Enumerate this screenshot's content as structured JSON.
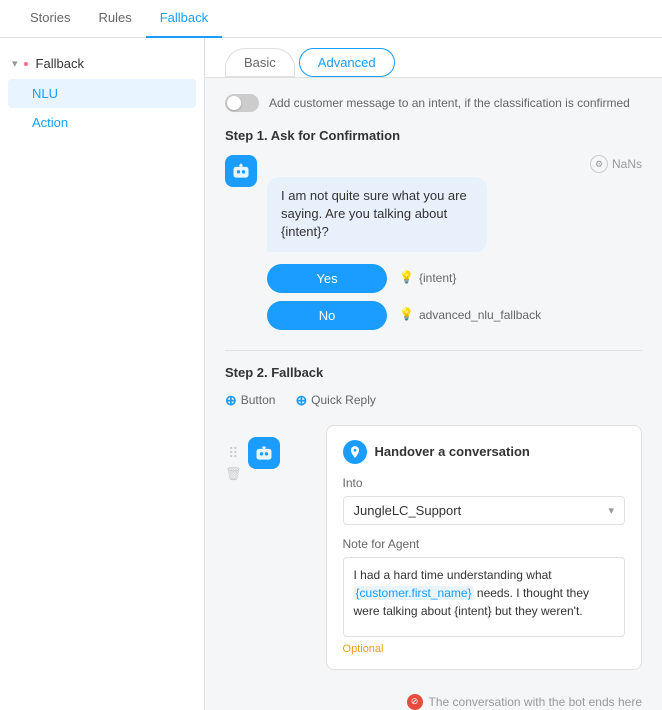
{
  "nav": {
    "items": [
      {
        "label": "Stories",
        "active": false
      },
      {
        "label": "Rules",
        "active": false
      },
      {
        "label": "Fallback",
        "active": true
      }
    ]
  },
  "sidebar": {
    "header": "Fallback",
    "items": [
      {
        "label": "NLU",
        "active": true
      },
      {
        "label": "Action",
        "active": false
      }
    ]
  },
  "tabs": {
    "basic": "Basic",
    "advanced": "Advanced"
  },
  "toggle": {
    "label": "Add customer message to an intent, if the classification is confirmed"
  },
  "step1": {
    "heading": "Step 1. Ask for Confirmation",
    "bot_message": "I am not quite sure what you are saying. Are you talking about {intent}?",
    "nans": "NaNs",
    "yes_label": "Yes",
    "no_label": "No",
    "yes_intent": "{intent}",
    "no_intent": "advanced_nlu_fallback"
  },
  "step2": {
    "heading": "Step 2. Fallback",
    "add_button_label": "Button",
    "add_quick_reply_label": "Quick Reply",
    "handover": {
      "title": "Handover a conversation",
      "into_label": "Into",
      "into_value": "JungleLC_Support",
      "note_label": "Note for Agent",
      "note_text": "I had a hard time understanding what {customer.first_name} needs. I thought they were talking about {intent} but they weren't.",
      "note_highlight": "{customer.first_name}",
      "optional_label": "Optional"
    }
  },
  "footer": {
    "text": "The conversation with the bot ends here"
  }
}
